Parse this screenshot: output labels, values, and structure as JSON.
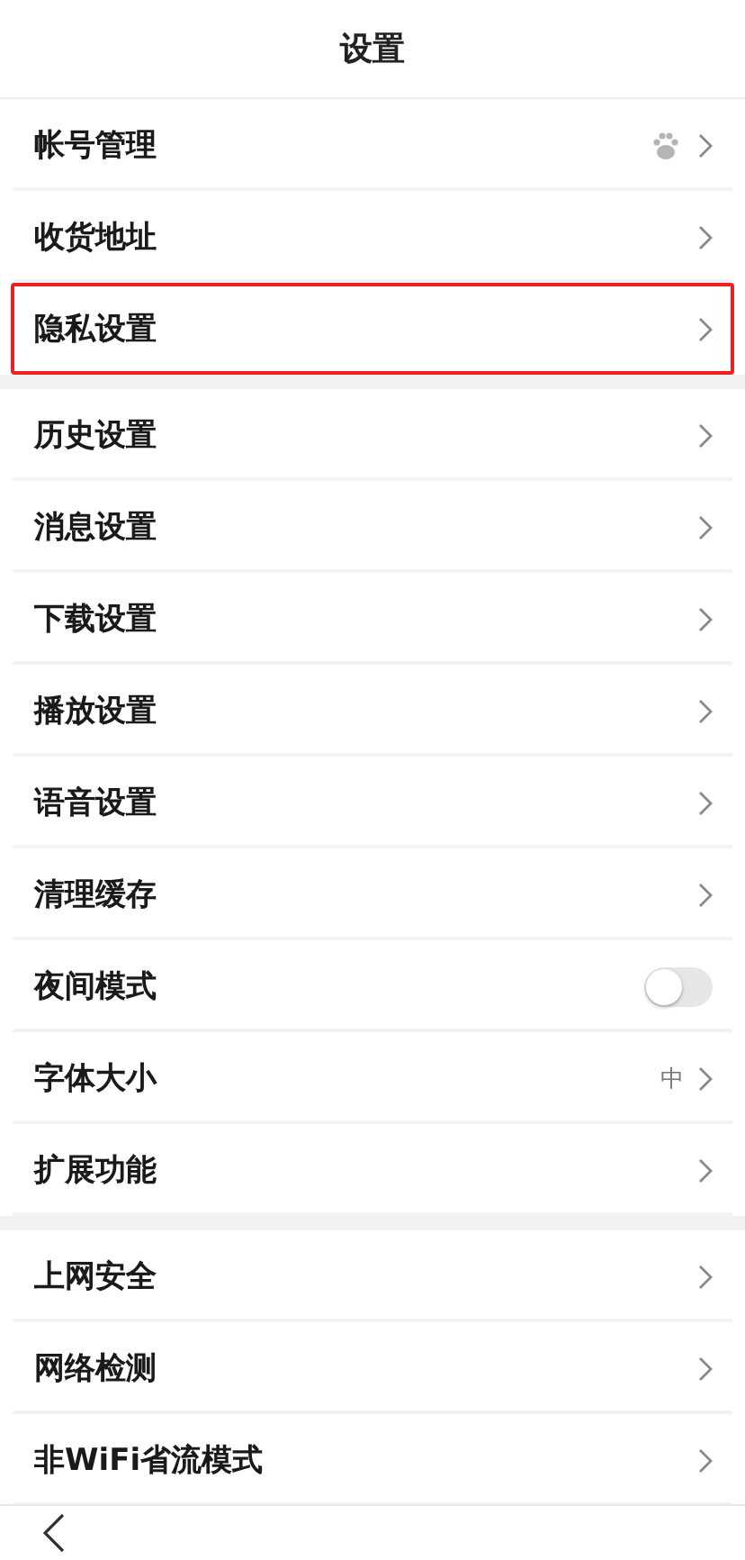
{
  "header": {
    "title": "设置"
  },
  "sections": [
    {
      "items": [
        {
          "kind": "account",
          "label": "帐号管理",
          "highlighted": false
        },
        {
          "kind": "link",
          "label": "收货地址",
          "highlighted": false
        },
        {
          "kind": "link",
          "label": "隐私设置",
          "highlighted": true
        }
      ]
    },
    {
      "items": [
        {
          "kind": "link",
          "label": "历史设置",
          "highlighted": false
        },
        {
          "kind": "link",
          "label": "消息设置",
          "highlighted": false
        },
        {
          "kind": "link",
          "label": "下载设置",
          "highlighted": false
        },
        {
          "kind": "link",
          "label": "播放设置",
          "highlighted": false
        },
        {
          "kind": "link",
          "label": "语音设置",
          "highlighted": false
        },
        {
          "kind": "link",
          "label": "清理缓存",
          "highlighted": false
        },
        {
          "kind": "toggle",
          "label": "夜间模式",
          "on": false,
          "highlighted": false
        },
        {
          "kind": "link",
          "label": "字体大小",
          "value": "中",
          "highlighted": false
        },
        {
          "kind": "link",
          "label": "扩展功能",
          "highlighted": false
        }
      ]
    },
    {
      "items": [
        {
          "kind": "link",
          "label": "上网安全",
          "highlighted": false
        },
        {
          "kind": "link",
          "label": "网络检测",
          "highlighted": false
        },
        {
          "kind": "link",
          "label": "非WiFi省流模式",
          "highlighted": false
        }
      ]
    }
  ]
}
